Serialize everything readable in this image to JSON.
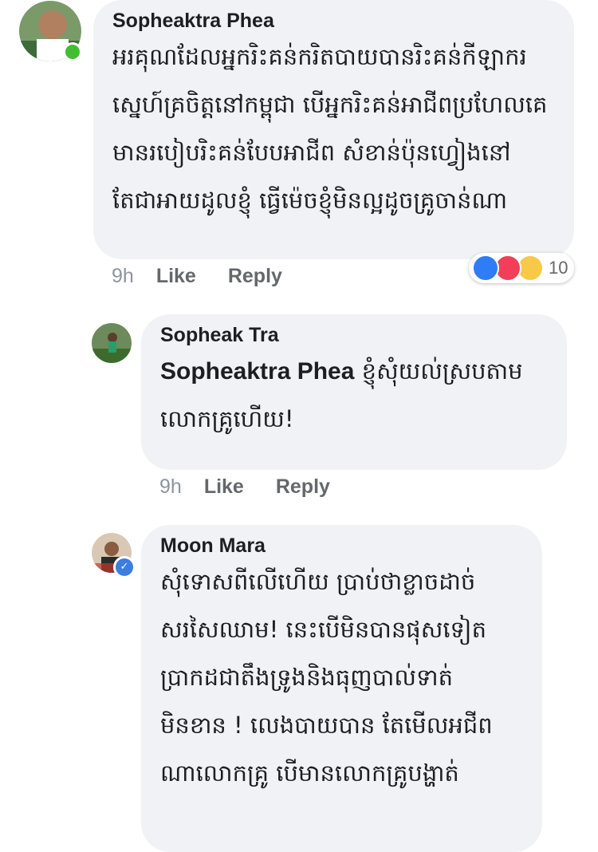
{
  "comments": [
    {
      "author": "Sopheaktra Phea",
      "lines": [
        "អរគុណដែលអ្នករិះគន់ករិតបាយបានរិះគន់កីឡាករ",
        "ស្នេហ៍គ្រចិត្តនៅកម្ពុជា បើអ្នករិះគន់អាជីពប្រហែលគេ",
        "មានរបៀបរិះគន់បែបអាជីព សំខាន់ប៉ុនហ្វៀងនៅ",
        "តែជាអាយដូលខ្ញុំ ធ្វើម៉េចខ្ញុំមិនល្អដូចគ្រូចាន់ណា"
      ],
      "time": "9h",
      "like_label": "Like",
      "reply_label": "Reply",
      "reactions": {
        "icons": [
          "like-icon",
          "love-icon",
          "haha-icon"
        ],
        "count": "10"
      }
    },
    {
      "author": "Sopheak Tra",
      "mention": "Sopheaktra Phea",
      "lines": [
        "ខ្ញុំសុំយល់ស្របតាម",
        "លោកគ្រូហើយ!"
      ],
      "time": "9h",
      "like_label": "Like",
      "reply_label": "Reply"
    },
    {
      "author": "Moon Mara",
      "lines": [
        "សុំទោសពីលើហើយ  ប្រាប់ថាខ្លាចដាច់",
        "សរសៃឈាម! នេះបើមិនបានផុសទៀត",
        "ប្រាកដជាតឹងទ្រូងនិងធុញបាល់ទាត់",
        "មិនខាន ! លេងបាយបាន តែមើលអជីព",
        "ណាលោកគ្រូ  បើមានលោកគ្រូបង្ហាត់"
      ]
    }
  ],
  "colors": {
    "bubble": "#f0f2f5",
    "text": "#1c1e21",
    "meta": "#65676b",
    "like_blue": "#2e7cf6",
    "love_red": "#f33e58",
    "haha_yellow": "#f7c948",
    "online_green": "#44bd32"
  }
}
